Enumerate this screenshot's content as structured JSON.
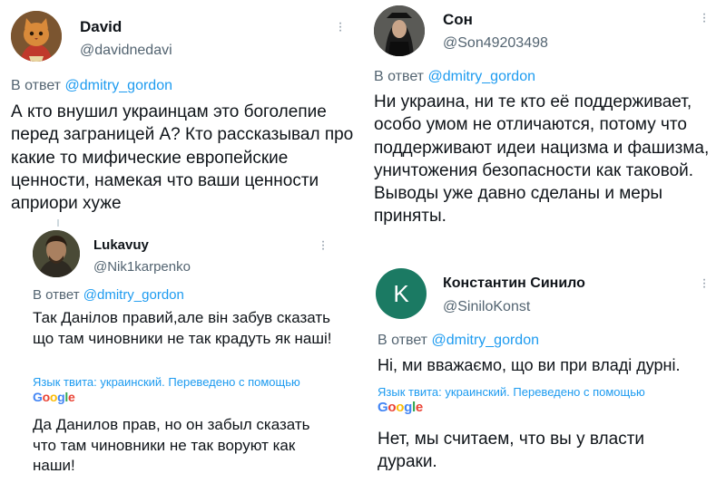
{
  "tweets": {
    "david": {
      "name": "David",
      "handle": "@davidnedavi",
      "reply_prefix": "В ответ",
      "mention": "@dmitry_gordon",
      "text": "А кто внушил украинцам это боголепие перед заграницей А? Кто рассказывал про какие то мифические европейские ценности, намекая что ваши ценности априори хуже"
    },
    "lukavuy": {
      "name": "Lukavuy",
      "handle": "@Nik1karpenko",
      "reply_prefix": "В ответ",
      "mention": "@dmitry_gordon",
      "text": "Так Данілов правий,але він забув сказать що там чиновники не так крадуть як наші!",
      "translation_note": "Язык твита: украинский. Переведено с помощью",
      "translation_provider": "Google",
      "translated_text": "Да Данилов прав, но он забыл сказать что там чиновники не так воруют как наши!"
    },
    "son": {
      "name": "Сон",
      "handle": "@Son49203498",
      "reply_prefix": "В ответ",
      "mention": "@dmitry_gordon",
      "text": "Ни украина, ни те кто её поддерживает, особо умом не отличаются, потому что поддерживают идеи нацизма и фашизма, уничтожения безопасности как таковой. Выводы уже давно сделаны и меры приняты."
    },
    "sinilo": {
      "name": "Константин Синило",
      "handle": "@SiniloKonst",
      "avatar_letter": "K",
      "reply_prefix": "В ответ",
      "mention": "@dmitry_gordon",
      "text": "Ні, ми вважаємо, що ви при владі дурні.",
      "translation_note": "Язык твита: украинский. Переведено с помощью",
      "translation_provider": "Google",
      "translated_text": "Нет, мы считаем, что вы у власти дураки."
    }
  },
  "colors": {
    "link": "#1d9bf0",
    "secondary_text": "#536471",
    "sinilo_avatar": "#1b7a63"
  }
}
